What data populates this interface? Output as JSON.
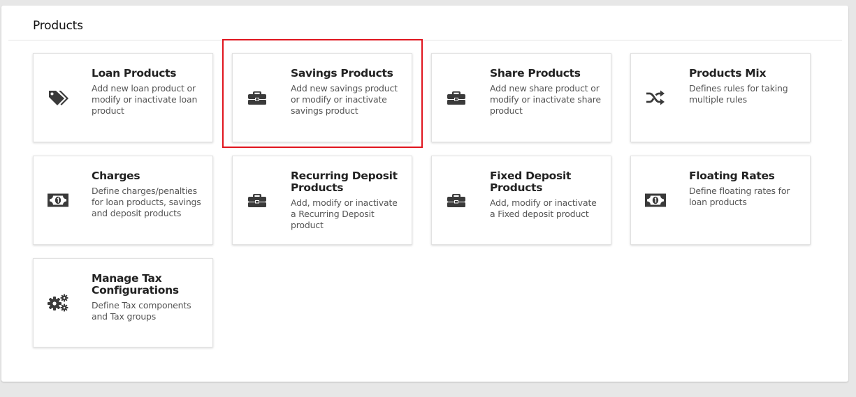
{
  "page": {
    "title": "Products"
  },
  "colors": {
    "background": "#e7e7e7",
    "panel": "#ffffff",
    "icon": "#3a3a3a",
    "highlight": "#e0151e"
  },
  "cards": [
    {
      "title": "Loan Products",
      "description": "Add new loan product or modify or inactivate loan product",
      "icon": "tags-icon"
    },
    {
      "title": "Savings Products",
      "description": "Add new savings product or modify or inactivate savings product",
      "icon": "briefcase-icon",
      "highlighted": true
    },
    {
      "title": "Share Products",
      "description": "Add new share product or modify or inactivate share product",
      "icon": "briefcase-icon"
    },
    {
      "title": "Products Mix",
      "description": "Defines rules for taking multiple rules",
      "icon": "shuffle-icon"
    },
    {
      "title": "Charges",
      "description": "Define charges/penalties for loan products, savings and deposit products",
      "icon": "money-bill-icon"
    },
    {
      "title": "Recurring Deposit Products",
      "description": "Add, modify or inactivate a Recurring Deposit product",
      "icon": "briefcase-icon"
    },
    {
      "title": "Fixed Deposit Products",
      "description": "Add, modify or inactivate a Fixed deposit product",
      "icon": "briefcase-icon"
    },
    {
      "title": "Floating Rates",
      "description": "Define floating rates for loan products",
      "icon": "money-bill-icon"
    },
    {
      "title": "Manage Tax Configurations",
      "description": "Define Tax components and Tax groups",
      "icon": "cogs-icon"
    }
  ]
}
